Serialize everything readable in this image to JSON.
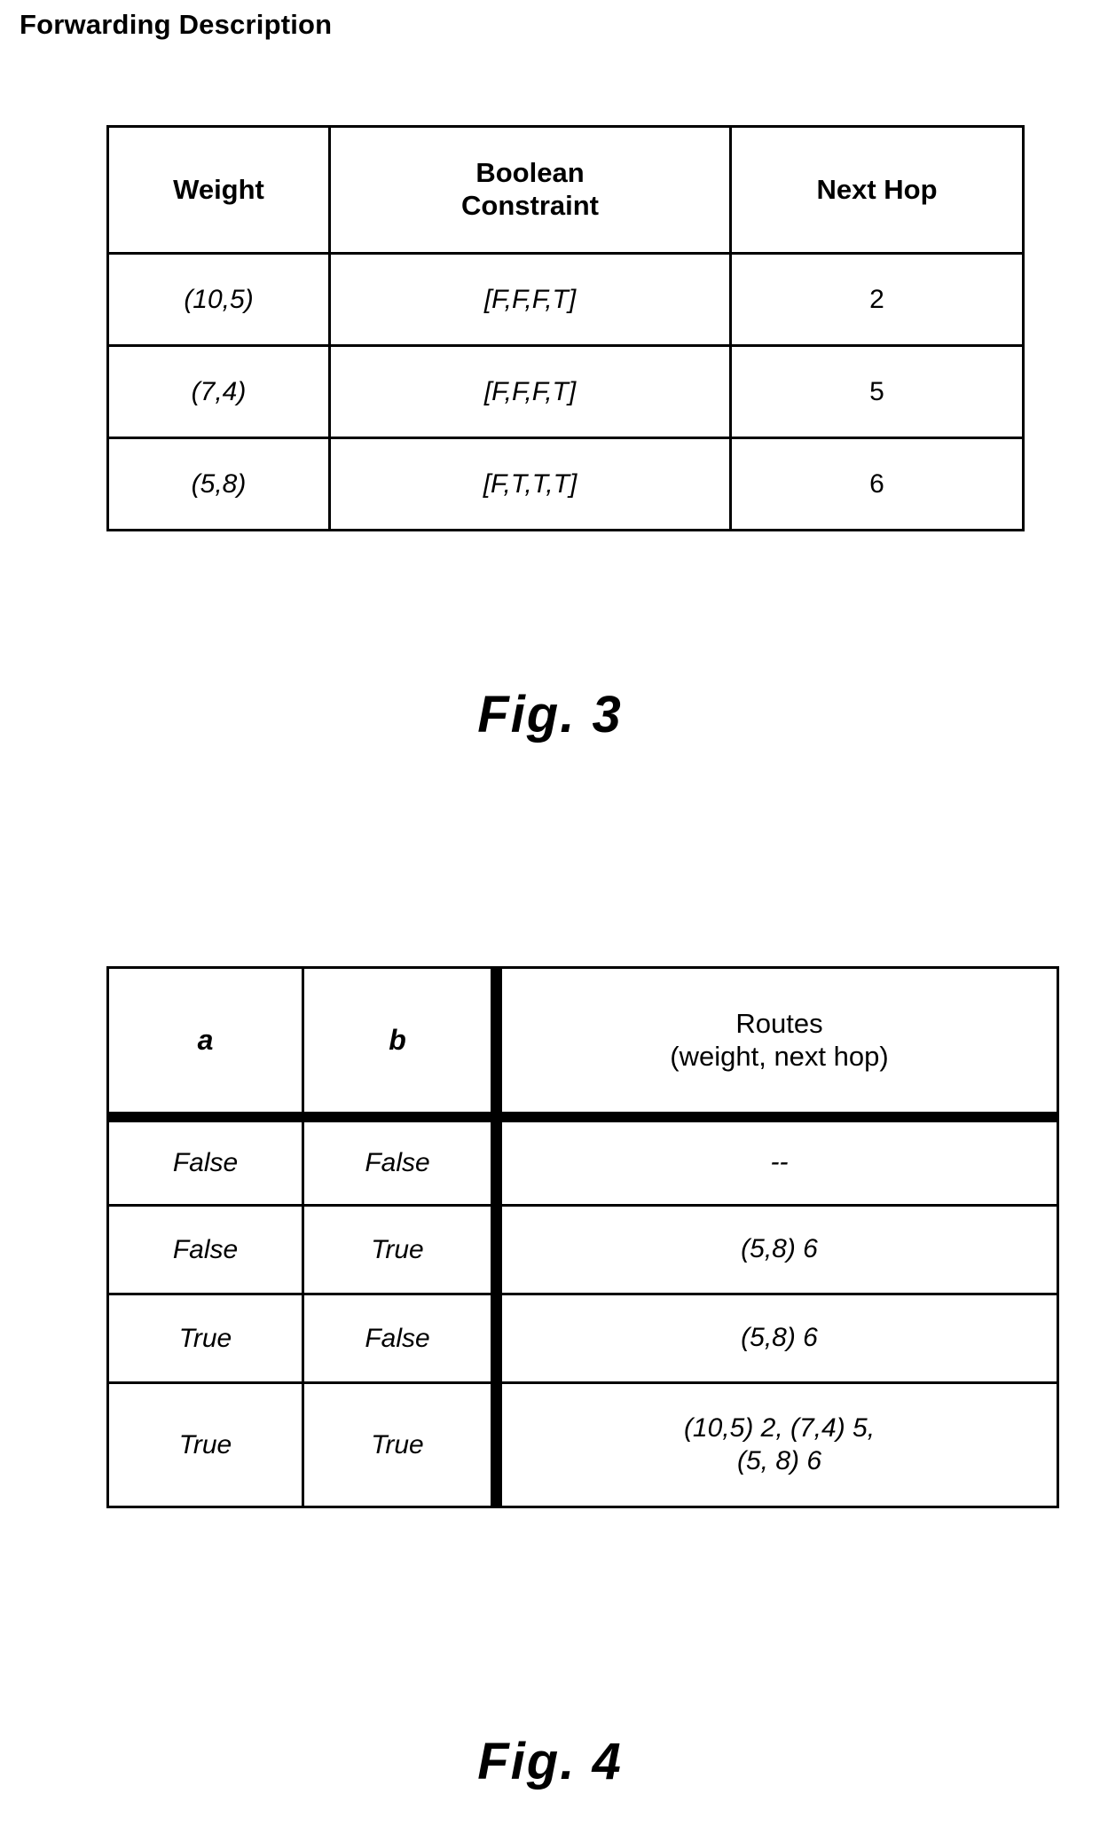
{
  "page": {
    "title": "Forwarding Description"
  },
  "figure3": {
    "caption": "Fig. 3",
    "columns": [
      "Weight",
      "Boolean\nConstraint",
      "Next Hop"
    ],
    "headers": {
      "weight": "Weight",
      "constraint_line1": "Boolean",
      "constraint_line2": "Constraint",
      "next_hop": "Next Hop"
    },
    "rows": [
      {
        "weight": "(10,5)",
        "constraint": "[F,F,F,T]",
        "next_hop": "2"
      },
      {
        "weight": "(7,4)",
        "constraint": "[F,F,F,T]",
        "next_hop": "5"
      },
      {
        "weight": "(5,8)",
        "constraint": "[F,T,T,T]",
        "next_hop": "6"
      }
    ]
  },
  "figure4": {
    "caption": "Fig. 4",
    "headers": {
      "a": "a",
      "b": "b",
      "routes_line1": "Routes",
      "routes_line2": "(weight, next hop)"
    },
    "rows": [
      {
        "a": "False",
        "b": "False",
        "routes_line1": "--",
        "routes_line2": ""
      },
      {
        "a": "False",
        "b": "True",
        "routes_line1": "(5,8) 6",
        "routes_line2": ""
      },
      {
        "a": "True",
        "b": "False",
        "routes_line1": "(5,8) 6",
        "routes_line2": ""
      },
      {
        "a": "True",
        "b": "True",
        "routes_line1": "(10,5) 2, (7,4) 5,",
        "routes_line2": "(5, 8) 6"
      }
    ]
  },
  "colors": {
    "ink": "#000000",
    "paper": "#ffffff"
  }
}
